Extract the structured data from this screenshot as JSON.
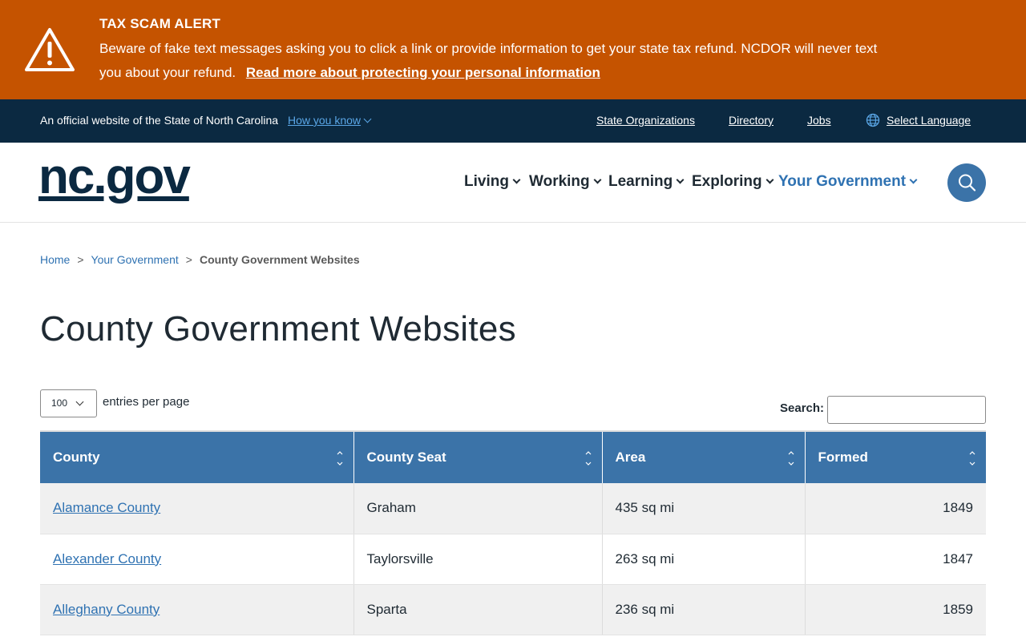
{
  "alert": {
    "title": "TAX SCAM ALERT",
    "message": "Beware of fake text messages asking you to click a link or provide information to get your state tax refund. NCDOR will never text you about your refund.",
    "link_label": "Read more about protecting your personal information",
    "icon": "warning-triangle-icon",
    "background_color": "#c55300"
  },
  "official_bar": {
    "text": "An official website of the State of North Carolina",
    "how_you_know": "How you know",
    "links": [
      "State Organizations",
      "Directory",
      "Jobs"
    ],
    "language_label": "Select Language",
    "background_color": "#0b2941"
  },
  "header": {
    "logo": "nc.gov",
    "nav": [
      "Living",
      "Working",
      "Learning",
      "Exploring",
      "Your Government"
    ],
    "active_nav": "Your Government",
    "search_icon": "search-icon"
  },
  "breadcrumb": {
    "items": [
      "Home",
      "Your Government"
    ],
    "current": "County Government Websites",
    "separator": ">"
  },
  "page": {
    "title": "County Government Websites"
  },
  "table_controls": {
    "entries_value": "100",
    "entries_label": "entries per page",
    "search_label": "Search:",
    "search_value": ""
  },
  "table": {
    "columns": [
      "County",
      "County Seat",
      "Area",
      "Formed"
    ],
    "header_color": "#3b73a8",
    "rows": [
      {
        "county": "Alamance County",
        "seat": "Graham",
        "area": "435 sq mi",
        "formed": "1849"
      },
      {
        "county": "Alexander County",
        "seat": "Taylorsville",
        "area": "263 sq mi",
        "formed": "1847"
      },
      {
        "county": "Alleghany County",
        "seat": "Sparta",
        "area": "236 sq mi",
        "formed": "1859"
      }
    ]
  }
}
